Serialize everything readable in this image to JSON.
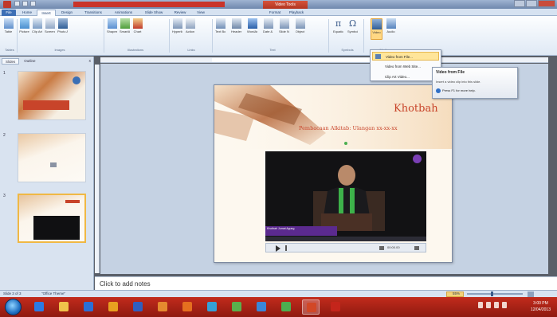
{
  "window": {
    "title": "",
    "context_tab_title": "Video Tools"
  },
  "tabs": [
    {
      "label": "File"
    },
    {
      "label": "Home"
    },
    {
      "label": "Insert"
    },
    {
      "label": "Design"
    },
    {
      "label": "Transitions"
    },
    {
      "label": "Animations"
    },
    {
      "label": "Slide Show"
    },
    {
      "label": "Review"
    },
    {
      "label": "View"
    },
    {
      "label": "Format"
    },
    {
      "label": "Playback"
    }
  ],
  "ribbon": {
    "buttons": [
      {
        "label": "Table"
      },
      {
        "label": "Picture"
      },
      {
        "label": "Clip Art"
      },
      {
        "label": "Screenshot"
      },
      {
        "label": "Photo Album"
      },
      {
        "label": "Shapes"
      },
      {
        "label": "SmartArt"
      },
      {
        "label": "Chart"
      },
      {
        "label": "Hyperlink"
      },
      {
        "label": "Action"
      },
      {
        "label": "Text Box"
      },
      {
        "label": "Header & Footer"
      },
      {
        "label": "WordArt"
      },
      {
        "label": "Date & Time"
      },
      {
        "label": "Slide Number"
      },
      {
        "label": "Object"
      },
      {
        "label": "Equation"
      },
      {
        "label": "Symbol"
      },
      {
        "label": "Video"
      },
      {
        "label": "Audio"
      }
    ],
    "groups": [
      {
        "label": "Tables"
      },
      {
        "label": "Images"
      },
      {
        "label": "Illustrations"
      },
      {
        "label": "Links"
      },
      {
        "label": "Text"
      },
      {
        "label": "Symbols"
      },
      {
        "label": "Media"
      }
    ]
  },
  "video_menu": {
    "items": [
      {
        "label": "Video from File..."
      },
      {
        "label": "Video from Web Site..."
      },
      {
        "label": "Clip Art Video..."
      }
    ]
  },
  "tooltip": {
    "title": "Video from File",
    "description": "Insert a video clip into this slide.",
    "help": "Press F1 for more help."
  },
  "left_pane": {
    "tabs": [
      {
        "label": "Slides"
      },
      {
        "label": "Outline"
      }
    ],
    "close": "x",
    "slides": [
      {
        "num": "1"
      },
      {
        "num": "2"
      },
      {
        "num": "3"
      }
    ]
  },
  "slide": {
    "title": "Khotbah",
    "subtitle": "Pembacaan Alkitab: Ulangan xx-xx-xx",
    "video_caption": "Khotbah Jumat Agung",
    "playbar_time": "00:00.00"
  },
  "notes": {
    "placeholder": "Click to add notes"
  },
  "status": {
    "slide": "Slide 3 of 3",
    "theme": "\"Office Theme\"",
    "zoom": "55%"
  },
  "taskbar": {
    "apps": [
      {
        "icon": "ie-icon",
        "color": "#2a7be4"
      },
      {
        "icon": "folder-icon",
        "color": "#f0c24a"
      },
      {
        "icon": "media-player-icon",
        "color": "#2b6fd6"
      },
      {
        "icon": "chrome-icon",
        "color": "#e8a020"
      },
      {
        "icon": "word-icon",
        "color": "#2f5fbf"
      },
      {
        "icon": "app-icon",
        "color": "#e58a2f"
      },
      {
        "icon": "firefox-icon",
        "color": "#e56f1f"
      },
      {
        "icon": "app-icon",
        "color": "#35a0d6"
      },
      {
        "icon": "app-icon",
        "color": "#5ab04c"
      },
      {
        "icon": "app-icon",
        "color": "#3a86d8"
      },
      {
        "icon": "app-icon",
        "color": "#4caf50"
      },
      {
        "icon": "powerpoint-icon",
        "color": "#d24726"
      },
      {
        "icon": "pdf-icon",
        "color": "#c4251b"
      }
    ],
    "clock": {
      "time": "3:00 PM",
      "date": "12/04/2013"
    }
  },
  "colors": {
    "title_accent": "#c8442a",
    "taskbar": "#b02418",
    "active_ribbon": "#ffd884"
  }
}
